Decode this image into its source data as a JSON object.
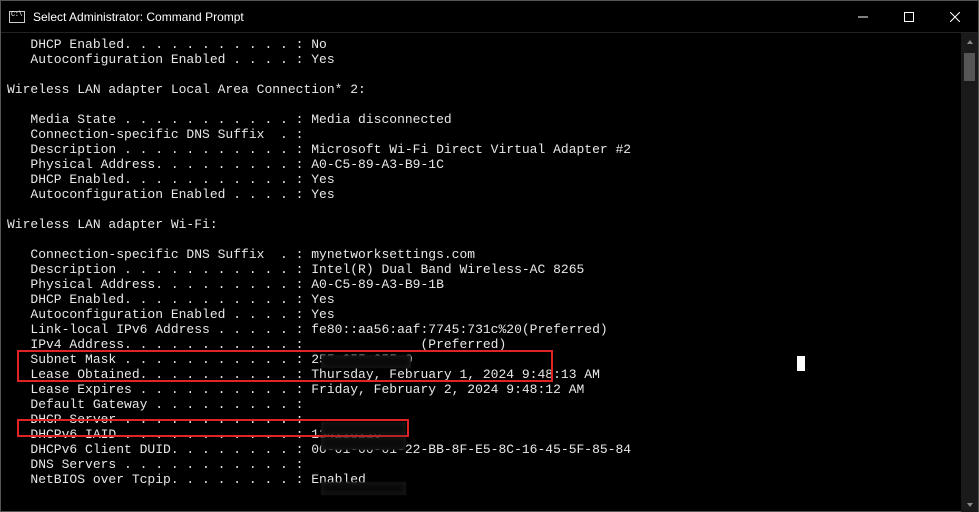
{
  "window": {
    "title": "Select Administrator: Command Prompt",
    "icon_label": "C:\\"
  },
  "term_text": "   DHCP Enabled. . . . . . . . . . . : No\n   Autoconfiguration Enabled . . . . : Yes\n\nWireless LAN adapter Local Area Connection* 2:\n\n   Media State . . . . . . . . . . . : Media disconnected\n   Connection-specific DNS Suffix  . :\n   Description . . . . . . . . . . . : Microsoft Wi-Fi Direct Virtual Adapter #2\n   Physical Address. . . . . . . . . : A0-C5-89-A3-B9-1C\n   DHCP Enabled. . . . . . . . . . . : Yes\n   Autoconfiguration Enabled . . . . : Yes\n\nWireless LAN adapter Wi-Fi:\n\n   Connection-specific DNS Suffix  . : mynetworksettings.com\n   Description . . . . . . . . . . . : Intel(R) Dual Band Wireless-AC 8265\n   Physical Address. . . . . . . . . : A0-C5-89-A3-B9-1B\n   DHCP Enabled. . . . . . . . . . . : Yes\n   Autoconfiguration Enabled . . . . : Yes\n   Link-local IPv6 Address . . . . . : fe80::aa56:aaf:7745:731c%20(Preferred)\n   IPv4 Address. . . . . . . . . . . :               (Preferred)\n   Subnet Mask . . . . . . . . . . . : 255.255.255.0\n   Lease Obtained. . . . . . . . . . : Thursday, February 1, 2024 9:48:13 AM\n   Lease Expires . . . . . . . . . . : Friday, February 2, 2024 9:48:12 AM\n   Default Gateway . . . . . . . . . :\n   DHCP Server . . . . . . . . . . . :\n   DHCPv6 IAID . . . . . . . . . . . : 134228216\n   DHCPv6 Client DUID. . . . . . . . : 00-01-00-01-22-BB-8F-E5-8C-16-45-5F-85-84\n   DNS Servers . . . . . . . . . . . :\n   NetBIOS over Tcpip. . . . . . . . : Enabled"
}
